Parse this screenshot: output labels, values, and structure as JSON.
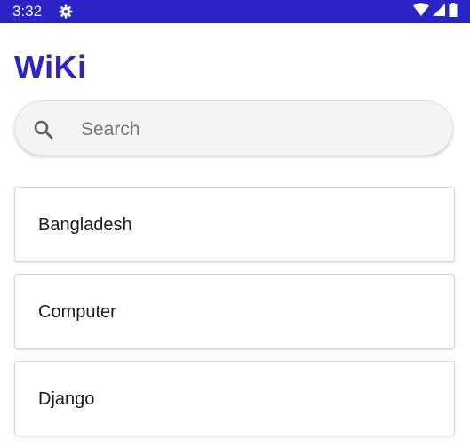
{
  "status_bar": {
    "time": "3:32",
    "background_color": "#2a24c8",
    "icons": [
      "gear-icon",
      "wifi-icon",
      "signal-icon",
      "battery-icon"
    ]
  },
  "app": {
    "title": "WiKi",
    "accent_color": "#2a24c8"
  },
  "search": {
    "placeholder": "Search",
    "value": "",
    "icon": "search-icon"
  },
  "list": {
    "items": [
      {
        "label": "Bangladesh"
      },
      {
        "label": "Computer"
      },
      {
        "label": "Django"
      }
    ]
  }
}
